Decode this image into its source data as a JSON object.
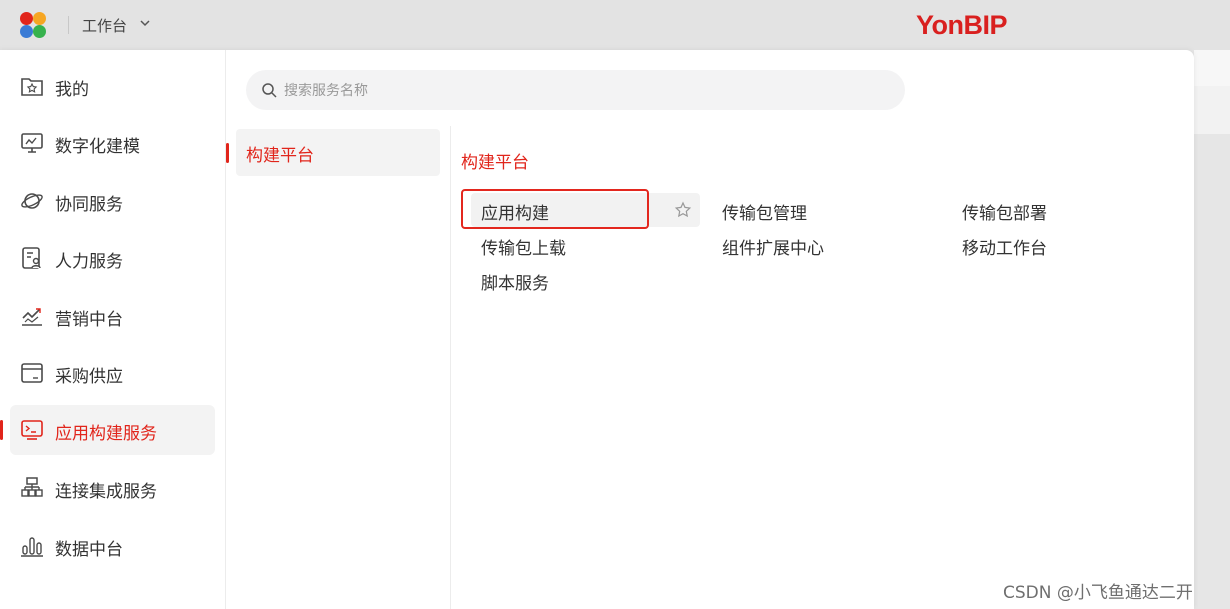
{
  "header": {
    "workspace_title": "工作台",
    "brand": "YonBIP",
    "logo_colors": [
      "#e1251b",
      "#f6a623",
      "#3a7bd5",
      "#37b24d"
    ]
  },
  "search": {
    "placeholder": "搜索服务名称",
    "value": ""
  },
  "sidebar": {
    "items": [
      {
        "label": "我的",
        "icon": "folder-star-icon"
      },
      {
        "label": "数字化建模",
        "icon": "monitor-chart-icon"
      },
      {
        "label": "协同服务",
        "icon": "planet-icon"
      },
      {
        "label": "人力服务",
        "icon": "person-card-icon"
      },
      {
        "label": "营销中台",
        "icon": "trend-chart-icon"
      },
      {
        "label": "采购供应",
        "icon": "window-icon"
      },
      {
        "label": "应用构建服务",
        "icon": "terminal-icon",
        "active": true
      },
      {
        "label": "连接集成服务",
        "icon": "network-icon"
      },
      {
        "label": "数据中台",
        "icon": "bar-chart-icon"
      }
    ]
  },
  "categories": [
    {
      "label": "构建平台",
      "active": true
    }
  ],
  "section": {
    "title": "构建平台",
    "services": [
      {
        "label": "应用构建",
        "highlighted": true
      },
      {
        "label": "传输包管理"
      },
      {
        "label": "传输包部署"
      },
      {
        "label": "传输包上载"
      },
      {
        "label": "组件扩展中心"
      },
      {
        "label": "移动工作台"
      },
      {
        "label": "脚本服务"
      }
    ]
  },
  "watermark": "CSDN @小飞鱼通达二开",
  "colors": {
    "accent": "#e1251b",
    "highlight_box": "#e3271e"
  }
}
